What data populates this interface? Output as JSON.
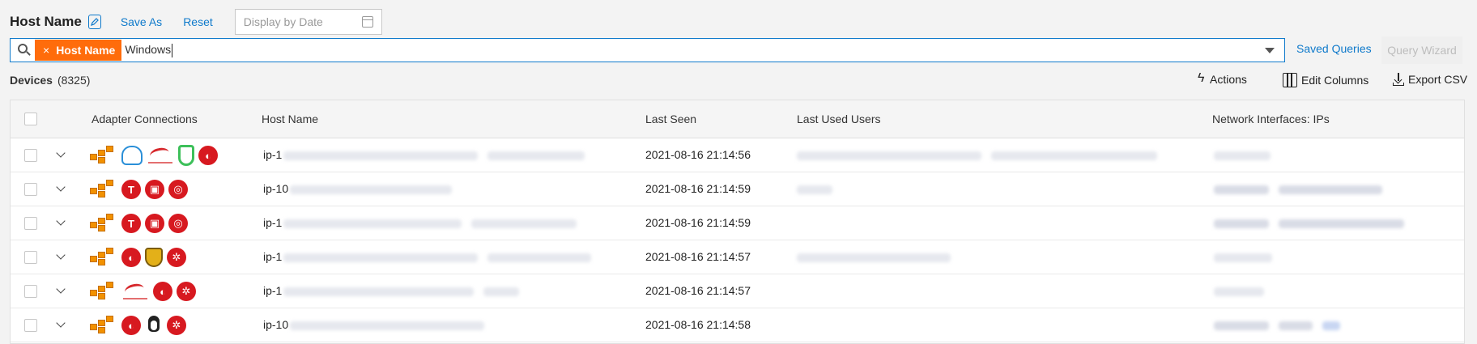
{
  "header": {
    "title": "Host Name",
    "save_as": "Save As",
    "reset": "Reset",
    "date_placeholder": "Display by Date"
  },
  "search": {
    "chip_label": "Host Name",
    "chip_remove": "×",
    "query": "Windows",
    "saved_queries": "Saved Queries",
    "query_wizard": "Query Wizard"
  },
  "devices": {
    "label": "Devices",
    "count": "(8325)",
    "actions": "Actions",
    "edit_columns": "Edit Columns",
    "export_csv": "Export CSV"
  },
  "table": {
    "columns": [
      "Adapter Connections",
      "Host Name",
      "Last Seen",
      "Last Used Users",
      "Network Interfaces: IPs"
    ],
    "rows": [
      {
        "host_prefix": "ip-1",
        "last_seen": "2021-08-16 21:14:56",
        "adapters": [
          "aws-icon",
          "cloud-icon",
          "crowdstrike-icon",
          "green-shield-icon",
          "trend-micro-icon"
        ]
      },
      {
        "host_prefix": "ip-10",
        "last_seen": "2021-08-16 21:14:59",
        "adapters": [
          "aws-icon",
          "tenable-icon",
          "red-square-icon",
          "red-target-icon"
        ]
      },
      {
        "host_prefix": "ip-1",
        "last_seen": "2021-08-16 21:14:59",
        "adapters": [
          "aws-icon",
          "tenable-icon",
          "red-square-icon",
          "red-target-icon"
        ]
      },
      {
        "host_prefix": "ip-1",
        "last_seen": "2021-08-16 21:14:57",
        "adapters": [
          "aws-icon",
          "trend-micro-icon",
          "gold-shield-icon",
          "red-network-icon"
        ]
      },
      {
        "host_prefix": "ip-1",
        "last_seen": "2021-08-16 21:14:57",
        "adapters": [
          "aws-icon",
          "crowdstrike-icon",
          "trend-micro-icon",
          "red-network-icon"
        ]
      },
      {
        "host_prefix": "ip-10",
        "last_seen": "2021-08-16 21:14:58",
        "adapters": [
          "aws-icon",
          "trend-micro-icon",
          "linux-icon",
          "red-network-icon"
        ]
      }
    ]
  },
  "colors": {
    "accent": "#0f7acb",
    "chip": "#ff6c0b"
  }
}
